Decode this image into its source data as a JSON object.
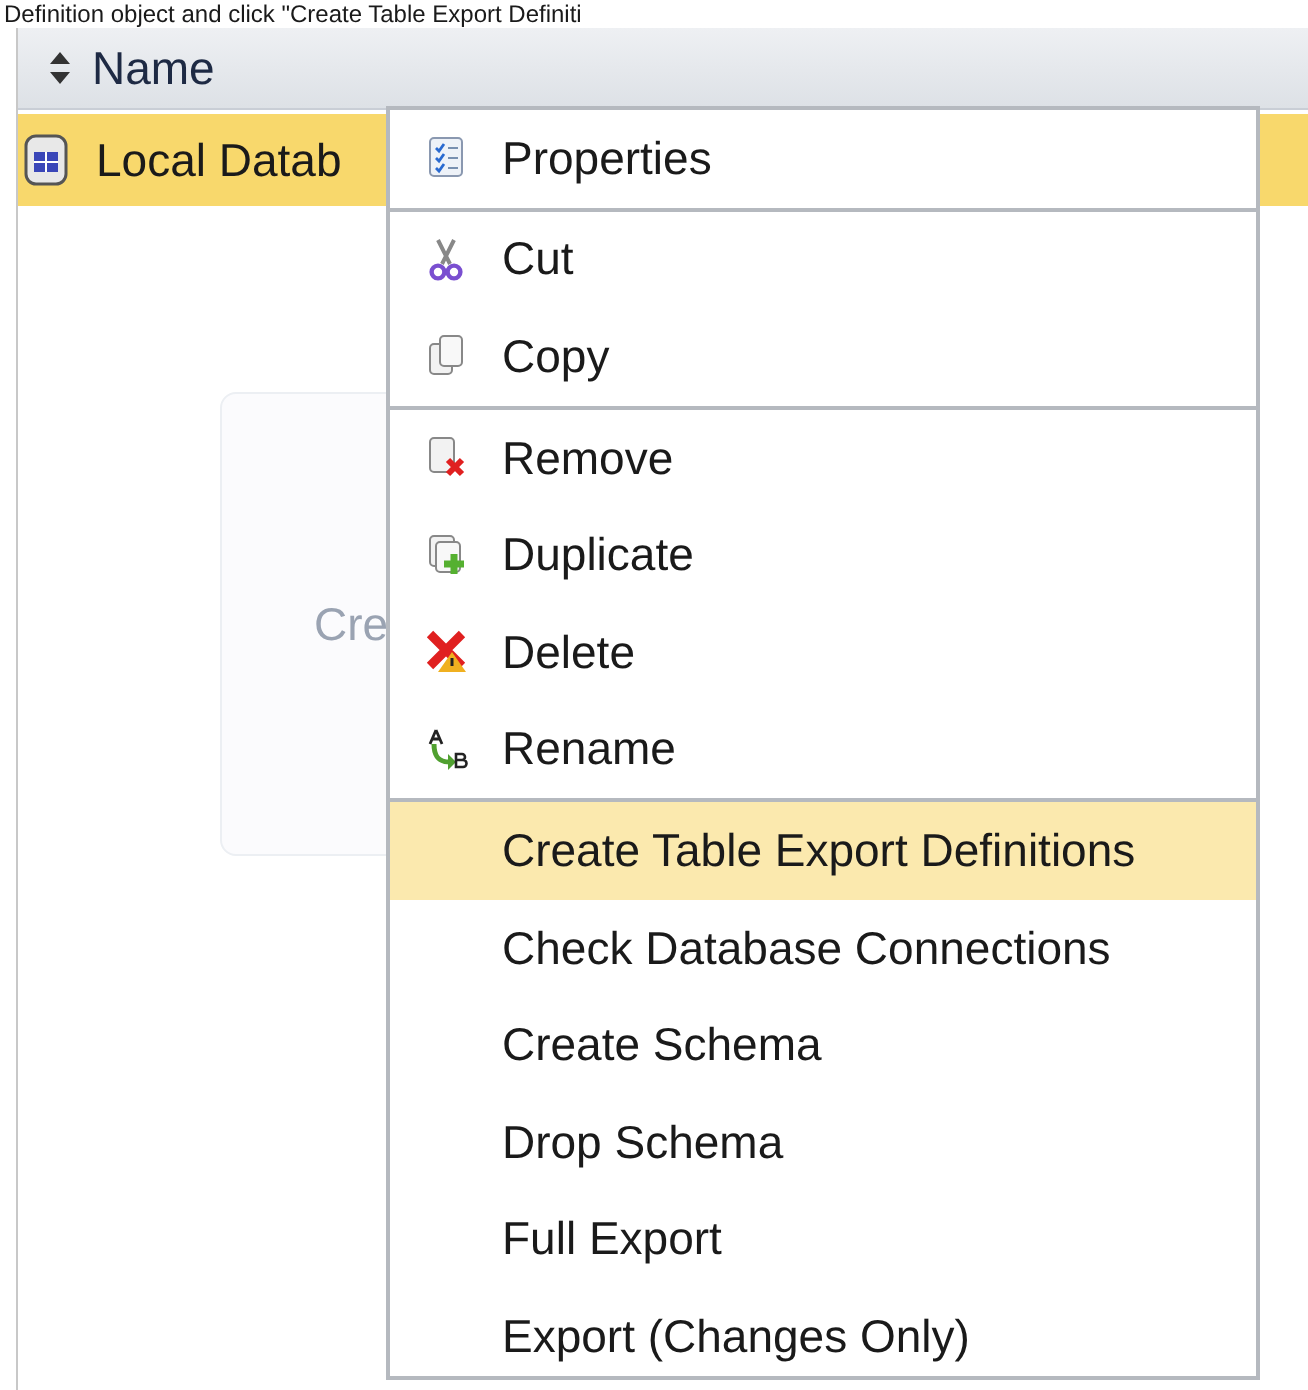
{
  "caption": "Definition object and click \"Create Table Export Definiti",
  "list": {
    "columns": [
      {
        "label": "Name",
        "sortable": true
      }
    ],
    "rows": [
      {
        "name": "Local Datab",
        "selected": true
      }
    ],
    "placeholder_card": {
      "text": "Cre"
    }
  },
  "context_menu": {
    "groups": [
      [
        {
          "label": "Properties",
          "kind": "icon",
          "selected": false
        }
      ],
      [
        {
          "label": "Cut",
          "kind": "icon",
          "selected": false
        },
        {
          "label": "Copy",
          "kind": "icon",
          "selected": false
        }
      ],
      [
        {
          "label": "Remove",
          "kind": "icon",
          "selected": false
        },
        {
          "label": "Duplicate",
          "kind": "icon",
          "selected": false
        },
        {
          "label": "Delete",
          "kind": "icon",
          "selected": false
        },
        {
          "label": "Rename",
          "kind": "icon",
          "selected": false
        }
      ],
      [
        {
          "label": "Create Table Export Definitions",
          "kind": "text",
          "selected": true
        },
        {
          "label": "Check Database Connections",
          "kind": "text",
          "selected": false
        },
        {
          "label": "Create Schema",
          "kind": "text",
          "selected": false
        },
        {
          "label": "Drop Schema",
          "kind": "text",
          "selected": false
        },
        {
          "label": "Full Export",
          "kind": "text",
          "selected": false
        },
        {
          "label": "Export (Changes Only)",
          "kind": "text",
          "selected": false
        }
      ]
    ]
  }
}
